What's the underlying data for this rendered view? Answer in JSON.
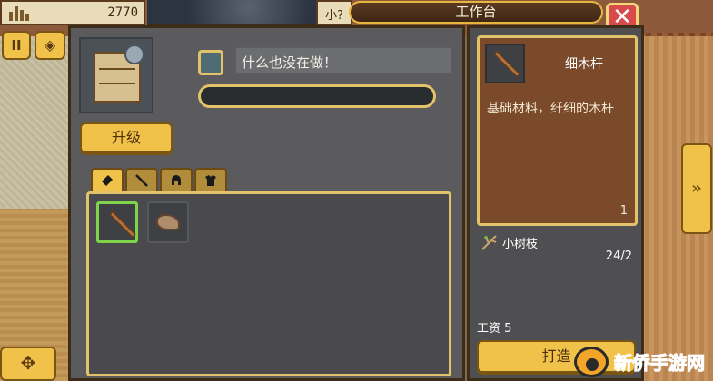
{
  "hud": {
    "resource_value": "2770",
    "small_label": "小?"
  },
  "title": "工作台",
  "close_glyph": "✕",
  "buttons": {
    "pause": "II",
    "map": "◈",
    "dpad": "✥",
    "next": "»",
    "upgrade": "升级",
    "craft": "打造"
  },
  "status": {
    "text": "什么也没在做！",
    "progress": 0
  },
  "tabs": [
    {
      "icon": "material-icon",
      "active": true
    },
    {
      "icon": "stick-icon",
      "active": false
    },
    {
      "icon": "helmet-icon",
      "active": false
    },
    {
      "icon": "armor-icon",
      "active": false
    }
  ],
  "items": [
    {
      "icon": "thin-wood-pole-icon",
      "selected": true
    },
    {
      "icon": "leaf-icon",
      "selected": false
    }
  ],
  "detail": {
    "name": "细木杆",
    "description": "基础材料，纤细的木杆",
    "count": "1",
    "ingredient_name": "小树枝",
    "ingredient_count": "24/2",
    "wage": "工资 5"
  },
  "watermark": "新侨手游网",
  "colors": {
    "accent_gold": "#f1c24a",
    "close_red": "#d94a4a",
    "selected_green": "#7ed44a",
    "panel_dark": "#5b5b5e"
  }
}
